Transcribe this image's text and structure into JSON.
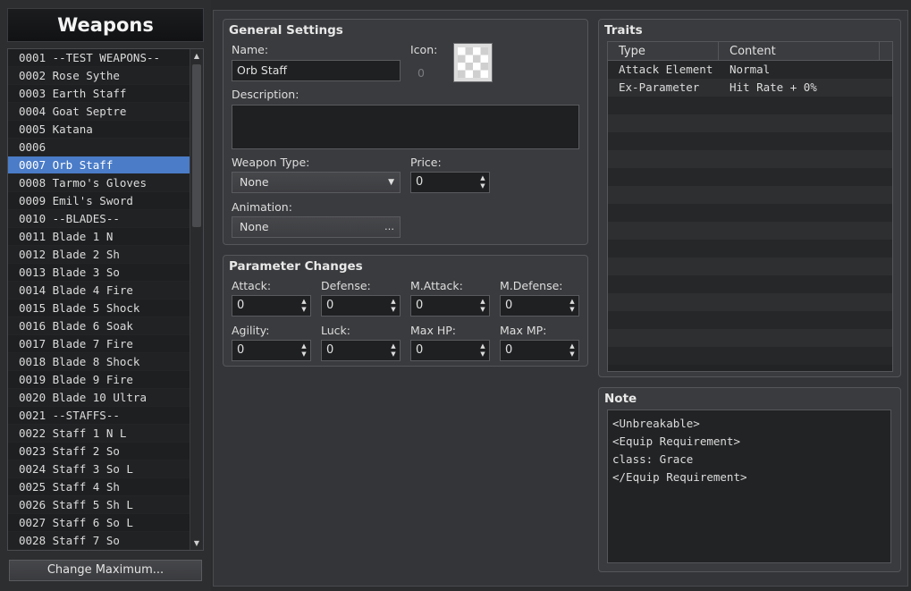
{
  "sidebar": {
    "title": "Weapons",
    "items": [
      "0001 --TEST WEAPONS--",
      "0002 Rose Sythe",
      "0003 Earth Staff",
      "0004 Goat Septre",
      "0005 Katana",
      "0006",
      "0007 Orb Staff",
      "0008 Tarmo's Gloves",
      "0009 Emil's Sword",
      "0010 --BLADES--",
      "0011 Blade 1 N",
      "0012 Blade 2 Sh",
      "0013 Blade 3 So",
      "0014 Blade 4 Fire",
      "0015 Blade 5 Shock",
      "0016 Blade 6 Soak",
      "0017 Blade 7 Fire",
      "0018 Blade 8 Shock",
      "0019 Blade 9 Fire",
      "0020 Blade 10 Ultra",
      "0021 --STAFFS--",
      "0022 Staff 1 N L",
      "0023 Staff 2 So",
      "0024 Staff 3 So L",
      "0025 Staff 4 Sh",
      "0026 Staff 5 Sh L",
      "0027 Staff 6 So L",
      "0028 Staff 7 So"
    ],
    "selected_index": 6,
    "change_max_label": "Change Maximum...",
    "scroll_up_icon": "▲",
    "scroll_down_icon": "▼"
  },
  "general": {
    "title": "General Settings",
    "name_label": "Name:",
    "name_value": "Orb Staff",
    "icon_label": "Icon:",
    "icon_index": "0",
    "description_label": "Description:",
    "description_value": "",
    "weapon_type_label": "Weapon Type:",
    "weapon_type_value": "None",
    "price_label": "Price:",
    "price_value": "0",
    "animation_label": "Animation:",
    "animation_value": "None",
    "animation_button": "…",
    "combo_caret": "▼",
    "spin_arrows": "▲▼"
  },
  "params": {
    "title": "Parameter Changes",
    "fields": [
      {
        "label": "Attack:",
        "value": "0"
      },
      {
        "label": "Defense:",
        "value": "0"
      },
      {
        "label": "M.Attack:",
        "value": "0"
      },
      {
        "label": "M.Defense:",
        "value": "0"
      },
      {
        "label": "Agility:",
        "value": "0"
      },
      {
        "label": "Luck:",
        "value": "0"
      },
      {
        "label": "Max HP:",
        "value": "0"
      },
      {
        "label": "Max MP:",
        "value": "0"
      }
    ]
  },
  "traits": {
    "title": "Traits",
    "columns": [
      "Type",
      "Content"
    ],
    "rows": [
      {
        "type": "Attack Element",
        "content": "Normal"
      },
      {
        "type": "Ex-Parameter",
        "content": "Hit Rate + 0%"
      }
    ]
  },
  "note": {
    "title": "Note",
    "lines": [
      "<Unbreakable>",
      "<Equip Requirement>",
      "class: Grace",
      "</Equip Requirement>"
    ]
  },
  "colors": {
    "selection": "#4a7cc8",
    "background": "#2b2c2e",
    "panel": "#3a3b3e"
  }
}
